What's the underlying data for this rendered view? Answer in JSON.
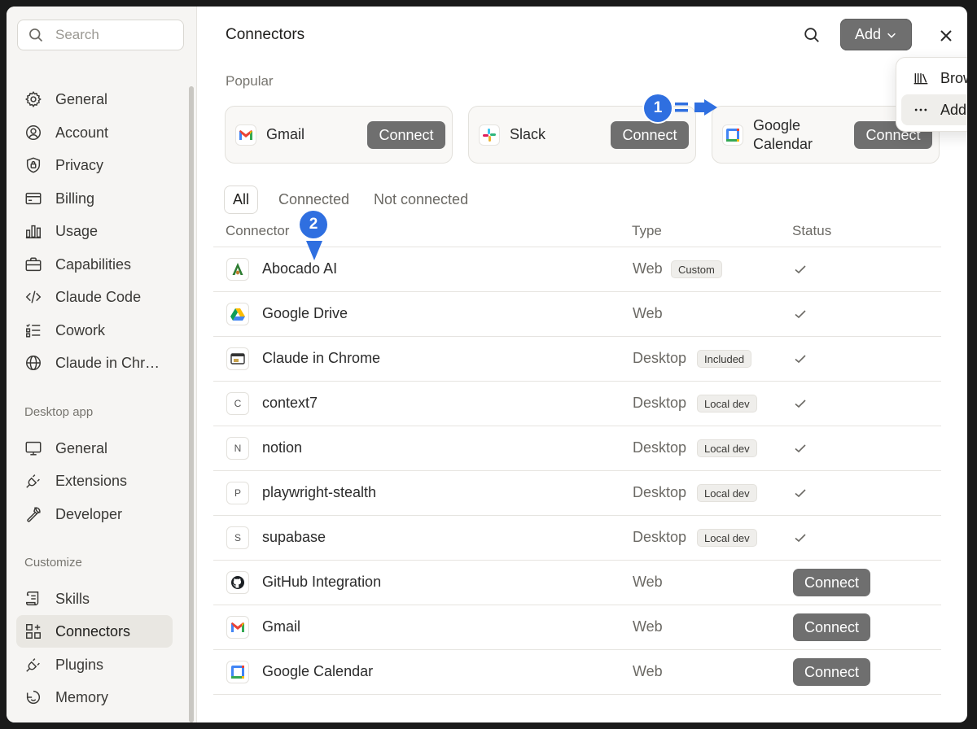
{
  "sidebar": {
    "search_placeholder": "Search",
    "items": [
      {
        "label": "General",
        "icon": "gear-icon"
      },
      {
        "label": "Account",
        "icon": "user-icon"
      },
      {
        "label": "Privacy",
        "icon": "shield-icon"
      },
      {
        "label": "Billing",
        "icon": "card-icon"
      },
      {
        "label": "Usage",
        "icon": "bar-chart-icon"
      },
      {
        "label": "Capabilities",
        "icon": "briefcase-icon"
      },
      {
        "label": "Claude Code",
        "icon": "code-icon"
      },
      {
        "label": "Cowork",
        "icon": "checklist-icon"
      },
      {
        "label": "Claude in Chr…",
        "icon": "globe-icon"
      }
    ],
    "desktop_section": "Desktop app",
    "desktop_items": [
      {
        "label": "General",
        "icon": "monitor-icon"
      },
      {
        "label": "Extensions",
        "icon": "plug-icon"
      },
      {
        "label": "Developer",
        "icon": "wrench-icon"
      }
    ],
    "customize_section": "Customize",
    "customize_items": [
      {
        "label": "Skills",
        "icon": "scroll-icon"
      },
      {
        "label": "Connectors",
        "icon": "grid-plus-icon"
      },
      {
        "label": "Plugins",
        "icon": "plug-icon"
      },
      {
        "label": "Memory",
        "icon": "memory-icon"
      }
    ]
  },
  "main": {
    "title": "Connectors",
    "add_label": "Add",
    "popular_label": "Popular",
    "popular": [
      {
        "name": "Gmail",
        "connect": "Connect"
      },
      {
        "name": "Slack",
        "connect": "Connect"
      },
      {
        "name": "Google Calendar",
        "connect": "Connect"
      }
    ],
    "filters": [
      "All",
      "Connected",
      "Not connected"
    ],
    "columns": {
      "connector": "Connector",
      "type": "Type",
      "status": "Status"
    },
    "rows": [
      {
        "name": "Abocado AI",
        "type": "Web",
        "tag": "Custom",
        "status": "connected",
        "logo": "abocado-logo-icon"
      },
      {
        "name": "Google Drive",
        "type": "Web",
        "tag": "",
        "status": "connected",
        "logo": "google-drive-logo-icon"
      },
      {
        "name": "Claude in Chrome",
        "type": "Desktop",
        "tag": "Included",
        "status": "connected",
        "logo": "chrome-window-icon"
      },
      {
        "name": "context7",
        "type": "Desktop",
        "tag": "Local dev",
        "status": "connected",
        "logo": "C"
      },
      {
        "name": "notion",
        "type": "Desktop",
        "tag": "Local dev",
        "status": "connected",
        "logo": "N"
      },
      {
        "name": "playwright-stealth",
        "type": "Desktop",
        "tag": "Local dev",
        "status": "connected",
        "logo": "P"
      },
      {
        "name": "supabase",
        "type": "Desktop",
        "tag": "Local dev",
        "status": "connected",
        "logo": "S"
      },
      {
        "name": "GitHub Integration",
        "type": "Web",
        "tag": "",
        "status": "Connect",
        "logo": "github-logo-icon"
      },
      {
        "name": "Gmail",
        "type": "Web",
        "tag": "",
        "status": "Connect",
        "logo": "gmail-logo-icon"
      },
      {
        "name": "Google Calendar",
        "type": "Web",
        "tag": "",
        "status": "Connect",
        "logo": "google-calendar-logo-icon"
      }
    ]
  },
  "dropdown": {
    "items": [
      {
        "label": "Browse connectors",
        "icon": "library-icon"
      },
      {
        "label": "Add custom connector",
        "icon": "ellipsis-icon"
      }
    ]
  },
  "annotations": {
    "marker1": "1",
    "marker2": "2",
    "accent": "#2f6fe0"
  }
}
